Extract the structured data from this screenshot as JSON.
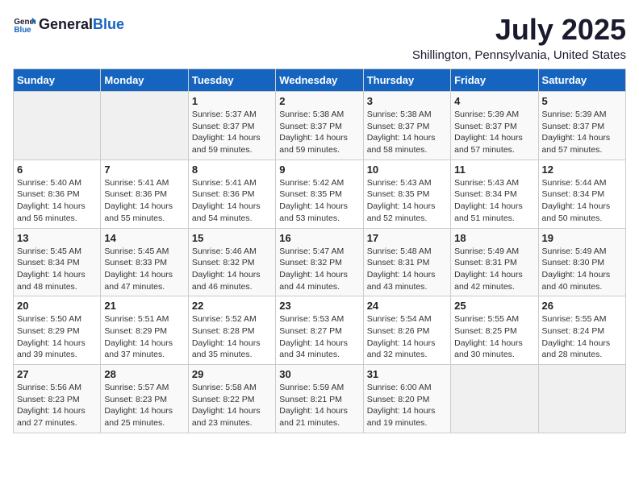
{
  "header": {
    "logo_general": "General",
    "logo_blue": "Blue",
    "title": "July 2025",
    "subtitle": "Shillington, Pennsylvania, United States"
  },
  "weekdays": [
    "Sunday",
    "Monday",
    "Tuesday",
    "Wednesday",
    "Thursday",
    "Friday",
    "Saturday"
  ],
  "weeks": [
    [
      {
        "day": "",
        "info": ""
      },
      {
        "day": "",
        "info": ""
      },
      {
        "day": "1",
        "info": "Sunrise: 5:37 AM\nSunset: 8:37 PM\nDaylight: 14 hours and 59 minutes."
      },
      {
        "day": "2",
        "info": "Sunrise: 5:38 AM\nSunset: 8:37 PM\nDaylight: 14 hours and 59 minutes."
      },
      {
        "day": "3",
        "info": "Sunrise: 5:38 AM\nSunset: 8:37 PM\nDaylight: 14 hours and 58 minutes."
      },
      {
        "day": "4",
        "info": "Sunrise: 5:39 AM\nSunset: 8:37 PM\nDaylight: 14 hours and 57 minutes."
      },
      {
        "day": "5",
        "info": "Sunrise: 5:39 AM\nSunset: 8:37 PM\nDaylight: 14 hours and 57 minutes."
      }
    ],
    [
      {
        "day": "6",
        "info": "Sunrise: 5:40 AM\nSunset: 8:36 PM\nDaylight: 14 hours and 56 minutes."
      },
      {
        "day": "7",
        "info": "Sunrise: 5:41 AM\nSunset: 8:36 PM\nDaylight: 14 hours and 55 minutes."
      },
      {
        "day": "8",
        "info": "Sunrise: 5:41 AM\nSunset: 8:36 PM\nDaylight: 14 hours and 54 minutes."
      },
      {
        "day": "9",
        "info": "Sunrise: 5:42 AM\nSunset: 8:35 PM\nDaylight: 14 hours and 53 minutes."
      },
      {
        "day": "10",
        "info": "Sunrise: 5:43 AM\nSunset: 8:35 PM\nDaylight: 14 hours and 52 minutes."
      },
      {
        "day": "11",
        "info": "Sunrise: 5:43 AM\nSunset: 8:34 PM\nDaylight: 14 hours and 51 minutes."
      },
      {
        "day": "12",
        "info": "Sunrise: 5:44 AM\nSunset: 8:34 PM\nDaylight: 14 hours and 50 minutes."
      }
    ],
    [
      {
        "day": "13",
        "info": "Sunrise: 5:45 AM\nSunset: 8:34 PM\nDaylight: 14 hours and 48 minutes."
      },
      {
        "day": "14",
        "info": "Sunrise: 5:45 AM\nSunset: 8:33 PM\nDaylight: 14 hours and 47 minutes."
      },
      {
        "day": "15",
        "info": "Sunrise: 5:46 AM\nSunset: 8:32 PM\nDaylight: 14 hours and 46 minutes."
      },
      {
        "day": "16",
        "info": "Sunrise: 5:47 AM\nSunset: 8:32 PM\nDaylight: 14 hours and 44 minutes."
      },
      {
        "day": "17",
        "info": "Sunrise: 5:48 AM\nSunset: 8:31 PM\nDaylight: 14 hours and 43 minutes."
      },
      {
        "day": "18",
        "info": "Sunrise: 5:49 AM\nSunset: 8:31 PM\nDaylight: 14 hours and 42 minutes."
      },
      {
        "day": "19",
        "info": "Sunrise: 5:49 AM\nSunset: 8:30 PM\nDaylight: 14 hours and 40 minutes."
      }
    ],
    [
      {
        "day": "20",
        "info": "Sunrise: 5:50 AM\nSunset: 8:29 PM\nDaylight: 14 hours and 39 minutes."
      },
      {
        "day": "21",
        "info": "Sunrise: 5:51 AM\nSunset: 8:29 PM\nDaylight: 14 hours and 37 minutes."
      },
      {
        "day": "22",
        "info": "Sunrise: 5:52 AM\nSunset: 8:28 PM\nDaylight: 14 hours and 35 minutes."
      },
      {
        "day": "23",
        "info": "Sunrise: 5:53 AM\nSunset: 8:27 PM\nDaylight: 14 hours and 34 minutes."
      },
      {
        "day": "24",
        "info": "Sunrise: 5:54 AM\nSunset: 8:26 PM\nDaylight: 14 hours and 32 minutes."
      },
      {
        "day": "25",
        "info": "Sunrise: 5:55 AM\nSunset: 8:25 PM\nDaylight: 14 hours and 30 minutes."
      },
      {
        "day": "26",
        "info": "Sunrise: 5:55 AM\nSunset: 8:24 PM\nDaylight: 14 hours and 28 minutes."
      }
    ],
    [
      {
        "day": "27",
        "info": "Sunrise: 5:56 AM\nSunset: 8:23 PM\nDaylight: 14 hours and 27 minutes."
      },
      {
        "day": "28",
        "info": "Sunrise: 5:57 AM\nSunset: 8:23 PM\nDaylight: 14 hours and 25 minutes."
      },
      {
        "day": "29",
        "info": "Sunrise: 5:58 AM\nSunset: 8:22 PM\nDaylight: 14 hours and 23 minutes."
      },
      {
        "day": "30",
        "info": "Sunrise: 5:59 AM\nSunset: 8:21 PM\nDaylight: 14 hours and 21 minutes."
      },
      {
        "day": "31",
        "info": "Sunrise: 6:00 AM\nSunset: 8:20 PM\nDaylight: 14 hours and 19 minutes."
      },
      {
        "day": "",
        "info": ""
      },
      {
        "day": "",
        "info": ""
      }
    ]
  ]
}
